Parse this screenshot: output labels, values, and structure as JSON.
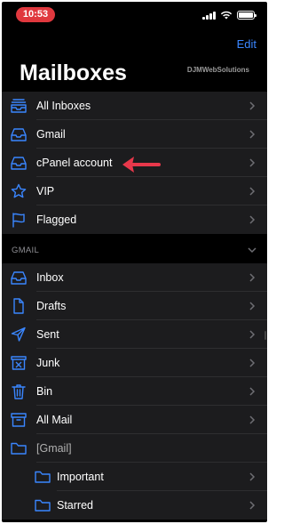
{
  "status_bar": {
    "time": "10:53"
  },
  "header": {
    "edit_label": "Edit",
    "title": "Mailboxes",
    "watermark": "DJMWebSolutions"
  },
  "mailboxes": [
    {
      "label": "All Inboxes",
      "icon": "tray-stack-icon"
    },
    {
      "label": "Gmail",
      "icon": "inbox-tray-icon"
    },
    {
      "label": "cPanel account",
      "icon": "inbox-tray-icon"
    },
    {
      "label": "VIP",
      "icon": "star-icon"
    },
    {
      "label": "Flagged",
      "icon": "flag-icon"
    }
  ],
  "gmail_section": {
    "title": "GMAIL",
    "items": [
      {
        "label": "Inbox",
        "icon": "inbox-tray-icon"
      },
      {
        "label": "Drafts",
        "icon": "document-icon"
      },
      {
        "label": "Sent",
        "icon": "paper-plane-icon"
      },
      {
        "label": "Junk",
        "icon": "junk-box-icon"
      },
      {
        "label": "Bin",
        "icon": "trash-icon"
      },
      {
        "label": "All Mail",
        "icon": "archive-box-icon"
      },
      {
        "label": "[Gmail]",
        "icon": "folder-icon"
      },
      {
        "label": "Important",
        "icon": "folder-icon"
      },
      {
        "label": "Starred",
        "icon": "folder-icon"
      }
    ]
  },
  "colors": {
    "accent": "#3a86ff",
    "annotation_arrow": "#e8384b",
    "time_pill": "#e0383e"
  }
}
